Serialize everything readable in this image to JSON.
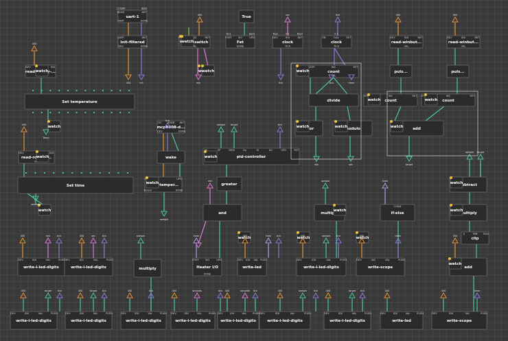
{
  "colors": {
    "orange": "#e8963a",
    "teal": "#4ec8a6",
    "purple": "#8c7ad6",
    "pink": "#e07ad6",
    "green": "#8cc84b",
    "yellow": "#f0c43c",
    "lilac": "#b89ae8",
    "white": "#e8e8e8"
  },
  "nodes": [
    {
      "id": "uart",
      "title": "uart-1",
      "top": [
        "BAUD",
        "INIT"
      ],
      "topvals": [
        "115200",
        "Boot"
      ],
      "bottom": [
        "UART",
        "DONE"
      ]
    },
    {
      "id": "initfiltered",
      "title": "init-filtered",
      "top": [
        "UART",
        "INIT"
      ],
      "bottom": [
        "DEV",
        "DONE"
      ]
    },
    {
      "id": "rs1",
      "title": "read-i-switch",
      "top": [
        "DEV",
        "IDX",
        "INIT"
      ],
      "bottom": [
        "VAL"
      ]
    },
    {
      "id": "fet",
      "title": "Fet",
      "top": [
        "PORT",
        "SIG",
        "UPD"
      ],
      "topvals": [
        "D11",
        "",
        "Boot"
      ],
      "bottom": [
        "DONE"
      ]
    },
    {
      "id": "true",
      "title": "True"
    },
    {
      "id": "clock1",
      "title": "clock",
      "top": [
        "DEV",
        "IDX",
        "INIT"
      ],
      "topvals": [
        "Tous",
        "0.1",
        "Boot"
      ],
      "bottom": [
        "TICK"
      ]
    },
    {
      "id": "clock2",
      "title": "clock",
      "top": [
        "EN",
        "IVAL",
        "RST"
      ],
      "topvals": [
        "",
        "0.1",
        ""
      ],
      "bottom": [
        "TICK"
      ]
    },
    {
      "id": "rw1",
      "title": "read-winbut...",
      "top": [
        "DEV",
        "IDX",
        "INIT"
      ],
      "bottom": [
        "VAL"
      ]
    },
    {
      "id": "rw2",
      "title": "read-winbut...",
      "top": [
        "DEV",
        "IDX",
        "INIT"
      ],
      "bottom": [
        "VAL"
      ]
    },
    {
      "id": "rr1",
      "title": "read-rotary-...",
      "top": [
        "DEV",
        "IDX"
      ],
      "bottom": [
        "VAL"
      ]
    },
    {
      "id": "count1",
      "title": "count",
      "top": [
        "STEP",
        "INC",
        "RST"
      ],
      "bottom": [
        "VAL"
      ]
    },
    {
      "id": "puls1",
      "title": "puls..."
    },
    {
      "id": "puls2",
      "title": "puls..."
    },
    {
      "id": "settemp",
      "title": "Set temperature"
    },
    {
      "id": "divide",
      "title": "divide"
    },
    {
      "id": "count2",
      "title": "count",
      "top": [
        "STEP",
        "INC",
        "RST"
      ]
    },
    {
      "id": "count3",
      "title": "count",
      "top": [
        "STEP",
        "INC",
        "RST"
      ]
    },
    {
      "id": "mcp",
      "title": "mcp9808-d...",
      "top": [
        "I2C",
        "ADDR",
        "INIT"
      ],
      "bottom": [
        "DEV",
        "DONE"
      ]
    },
    {
      "id": "floor",
      "title": "floor"
    },
    {
      "id": "modulo",
      "title": "modulo"
    },
    {
      "id": "add1",
      "title": "add"
    },
    {
      "id": "wake",
      "title": "wake"
    },
    {
      "id": "pid",
      "title": "pid-controller",
      "top": [
        "IN",
        "SP",
        "DIRE",
        "Kp",
        "Ki",
        "Kd",
        "UPD",
        "RST"
      ]
    },
    {
      "id": "rr2",
      "title": "read-rotary-...",
      "top": [
        "DEV",
        "IDX"
      ],
      "bottom": [
        "VAL"
      ]
    },
    {
      "id": "settime",
      "title": "Set time"
    },
    {
      "id": "readtemp",
      "title": "read-temper...",
      "top": [
        "DEV",
        "UPD"
      ],
      "bottom": [
        "Temp0",
        "DONE"
      ]
    },
    {
      "id": "greater",
      "title": "greater"
    },
    {
      "id": "subtract",
      "title": "subtract"
    },
    {
      "id": "and",
      "title": "and"
    },
    {
      "id": "multiply1",
      "title": "multiply"
    },
    {
      "id": "ifelse",
      "title": "if-else",
      "top": [
        "COND"
      ]
    },
    {
      "id": "multiply2",
      "title": "multiply"
    },
    {
      "id": "clip",
      "title": "clip",
      "top": [
        "X",
        "MIN",
        "MAX"
      ]
    },
    {
      "id": "w4a",
      "title": "write-i-led-digits",
      "top": [
        "DEV",
        "IDX",
        "VAL",
        "PUSH"
      ]
    },
    {
      "id": "w4b",
      "title": "write-i-led-digits",
      "top": [
        "DEV",
        "IDX",
        "VAL",
        "PUSH"
      ]
    },
    {
      "id": "multiply3",
      "title": "multiply"
    },
    {
      "id": "heater",
      "title": "Heater I/O",
      "top": [
        "PORT",
        "SIG",
        "UPD"
      ],
      "bottom": [
        "DONE"
      ]
    },
    {
      "id": "wled1",
      "title": "write-led",
      "top": [
        "DEV",
        "IDX",
        "VAL",
        "PUSH"
      ]
    },
    {
      "id": "w4c",
      "title": "write-i-led-digits",
      "top": [
        "DEV",
        "IDX",
        "VAL",
        "PUSH"
      ]
    },
    {
      "id": "wscope1",
      "title": "write-scope",
      "top": [
        "DEV",
        "IDX",
        "VAL",
        "PUSH"
      ]
    },
    {
      "id": "add2",
      "title": "add"
    },
    {
      "id": "b1",
      "title": "write-i-led-digits",
      "top": [
        "DEV",
        "IDX",
        "VAL",
        "PUSH"
      ]
    },
    {
      "id": "b2",
      "title": "write-i-led-digits",
      "top": [
        "DEV",
        "IDX",
        "VAL",
        "PUSH"
      ]
    },
    {
      "id": "b3",
      "title": "write-i-led-digits",
      "top": [
        "DEV",
        "IDX",
        "VAL",
        "PUSH"
      ]
    },
    {
      "id": "b4",
      "title": "write-i-led-digits",
      "top": [
        "DEV",
        "IDX",
        "VAL",
        "PUSH"
      ]
    },
    {
      "id": "b5",
      "title": "write-i-led-digits",
      "top": [
        "DEV",
        "IDX",
        "VAL",
        "PUSH"
      ]
    },
    {
      "id": "b6",
      "title": "write-i-led-digits",
      "top": [
        "DEV",
        "IDX",
        "VAL",
        "PUSH"
      ]
    },
    {
      "id": "b7",
      "title": "write-i-led-digits",
      "top": [
        "DEV",
        "IDX",
        "VAL",
        "PUSH"
      ]
    },
    {
      "id": "b8",
      "title": "write-led",
      "top": [
        "DEV",
        "IDX",
        "VAL",
        "PUSH"
      ]
    },
    {
      "id": "b9",
      "title": "write-scope",
      "top": [
        "DEV",
        "IDX",
        "VAL",
        "PUSH"
      ]
    }
  ],
  "watch_label": "watch",
  "pin_values": {
    "v400": "400",
    "vsec": "sec",
    "vtick": "tick",
    "vsample": "sample",
    "vtarget": "target",
    "vheat": "heat",
    "vtimer": "timer",
    "vmin": "min",
    "vseconds": "seconds",
    "vtemp": "Temp",
    "vtrue": "True",
    "v20": "20",
    "vleft": "left",
    "vboot": "Boot"
  }
}
